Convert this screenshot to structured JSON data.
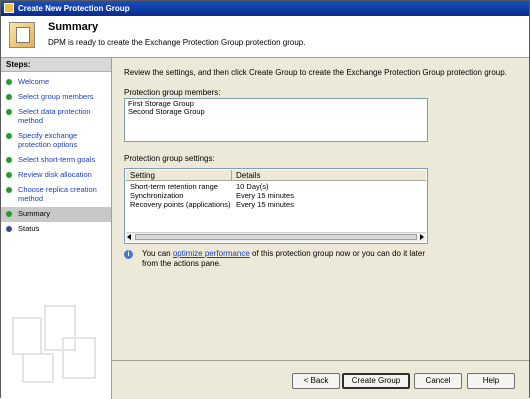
{
  "window": {
    "title": "Create New Protection Group"
  },
  "header": {
    "title": "Summary",
    "subtitle": "DPM is ready to create the Exchange Protection Group protection group.",
    "icon": "protection-group-icon"
  },
  "sidebar": {
    "title": "Steps:",
    "items": [
      {
        "label": "Welcome",
        "state": "done"
      },
      {
        "label": "Select group members",
        "state": "done"
      },
      {
        "label": "Select data protection method",
        "state": "done"
      },
      {
        "label": "Specify exchange protection options",
        "state": "done"
      },
      {
        "label": "Select short-term goals",
        "state": "done"
      },
      {
        "label": "Review disk allocation",
        "state": "done"
      },
      {
        "label": "Choose replica creation method",
        "state": "done"
      },
      {
        "label": "Summary",
        "state": "current"
      },
      {
        "label": "Status",
        "state": "pending"
      }
    ]
  },
  "main": {
    "instruction": "Review the settings, and then click Create Group to create the Exchange Protection Group protection group.",
    "members_label": "Protection group members:",
    "members": [
      "First Storage Group",
      "Second Storage Group"
    ],
    "settings_label": "Protection group settings:",
    "settings_columns": [
      "Setting",
      "Details"
    ],
    "settings_rows": [
      {
        "setting": "Short-term retention range",
        "details": "10 Day(s)"
      },
      {
        "setting": "Synchronization",
        "details": "Every 15 minutes"
      },
      {
        "setting": "Recovery points (applications)",
        "details": "Every 15 minutes"
      }
    ],
    "info_before": "You can ",
    "info_link": "optimize performance",
    "info_after": " of this protection group now or you can do it later from the actions pane."
  },
  "footer": {
    "back_label": "< Back",
    "create_label": "Create Group",
    "cancel_label": "Cancel",
    "help_label": "Help"
  },
  "colors": {
    "title_bar": "#0a2a8a",
    "link": "#1a3fc0",
    "done_dot": "#2a9a2a",
    "pending_dot": "#3a4aa0"
  }
}
